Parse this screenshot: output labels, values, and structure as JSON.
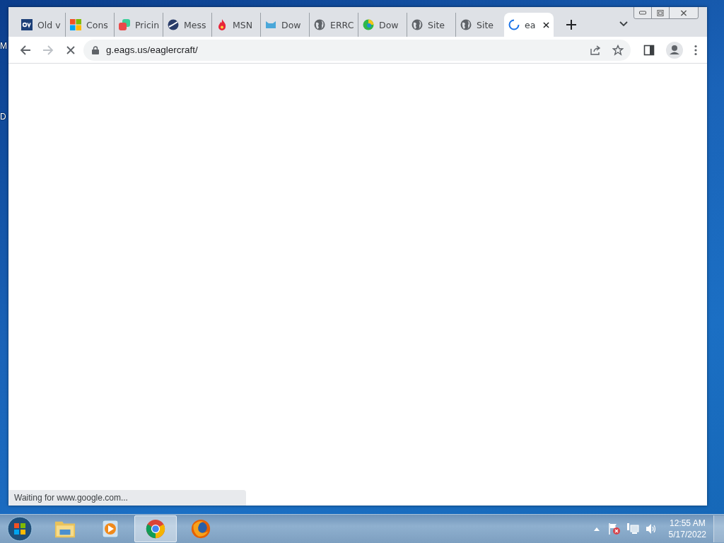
{
  "desktop_labels": [
    "M",
    "D"
  ],
  "browser": {
    "tabs": [
      {
        "title": "Old v",
        "kind": "ov",
        "selected": false
      },
      {
        "title": "Cons",
        "kind": "windows",
        "selected": false
      },
      {
        "title": "Pricin",
        "kind": "squares",
        "selected": false
      },
      {
        "title": "Mess",
        "kind": "sphere",
        "selected": false
      },
      {
        "title": "MSN",
        "kind": "flame",
        "selected": false
      },
      {
        "title": "Dow",
        "kind": "cat",
        "selected": false
      },
      {
        "title": "ERRC",
        "kind": "globe",
        "selected": false
      },
      {
        "title": "Dow",
        "kind": "edge",
        "selected": false
      },
      {
        "title": "Site",
        "kind": "globe",
        "selected": false
      },
      {
        "title": "Site",
        "kind": "globe",
        "selected": false
      },
      {
        "title": "ea",
        "kind": "spinner",
        "selected": true
      }
    ],
    "loading": true,
    "address": "g.eags.us/eaglercraft/",
    "status": "Waiting for www.google.com..."
  },
  "taskbar": {
    "apps": [
      {
        "kind": "explorer",
        "selected": false
      },
      {
        "kind": "media",
        "selected": false
      },
      {
        "kind": "chrome",
        "selected": true
      },
      {
        "kind": "firefox",
        "selected": false
      }
    ],
    "time": "12:55 AM",
    "date": "5/17/2022"
  }
}
